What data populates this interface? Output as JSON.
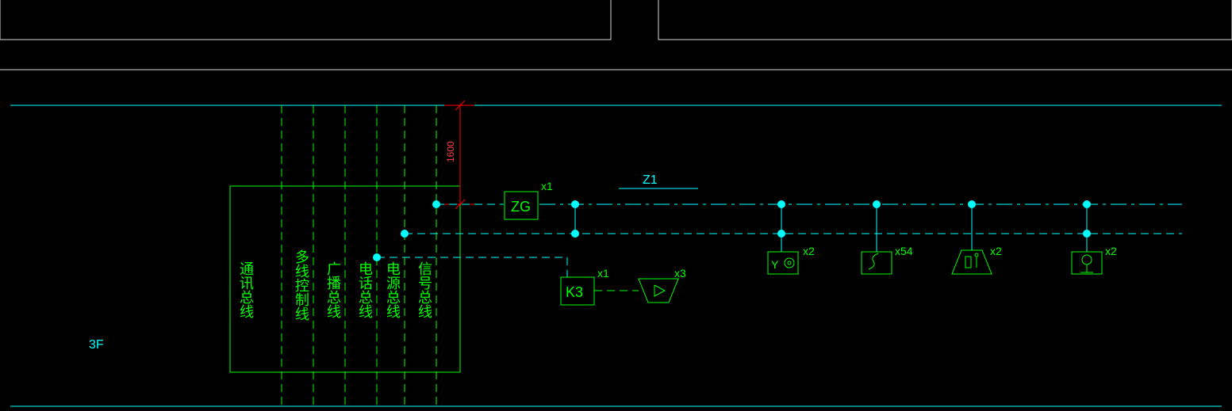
{
  "floor_label": "3F",
  "dimension_1": "1600",
  "zone_label": "Z1",
  "bus_labels": {
    "comm": "通讯总线",
    "multi_ctrl": "多线控制线",
    "broadcast": "广播总线",
    "phone": "电话总线",
    "power": "电源总线",
    "signal": "信号总线"
  },
  "devices": {
    "zg": {
      "label": "ZG",
      "qty": "x1"
    },
    "k3": {
      "label": "K3",
      "qty": "x1"
    },
    "speaker": {
      "qty": "x3"
    },
    "alarm": {
      "qty": "x2"
    },
    "detector": {
      "qty": "x54"
    },
    "manual": {
      "qty": "x2"
    },
    "hydrant": {
      "qty": "x2"
    }
  }
}
